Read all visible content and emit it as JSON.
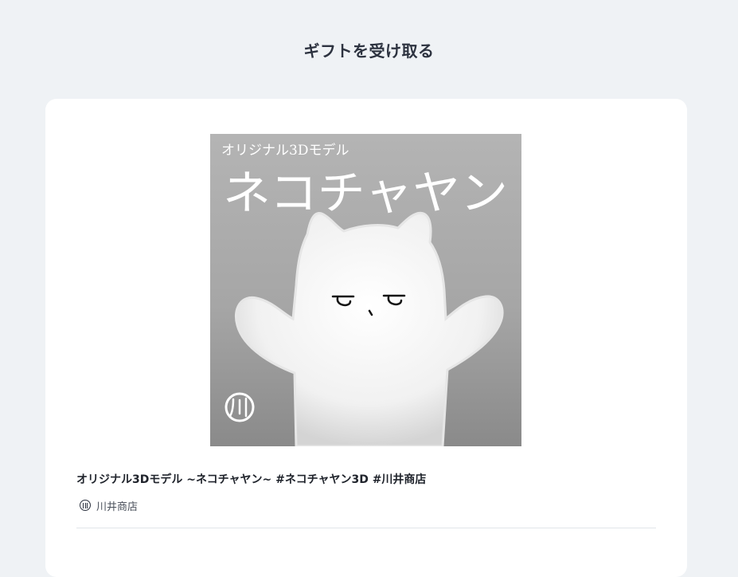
{
  "page": {
    "title": "ギフトを受け取る"
  },
  "product": {
    "image": {
      "caption_small": "オリジナル3Dモデル",
      "caption_large": "ネコチャヤン",
      "logo_glyph": "川"
    },
    "title": "オリジナル3Dモデル ~ネコチャヤン~ #ネコチャヤン3D #川井商店",
    "shop": {
      "name": "川井商店",
      "logo_icon": "shop-logo-icon"
    }
  },
  "colors": {
    "background": "#eff2f5",
    "card": "#ffffff",
    "text_primary": "#20242c",
    "text_secondary": "#4a505b"
  }
}
